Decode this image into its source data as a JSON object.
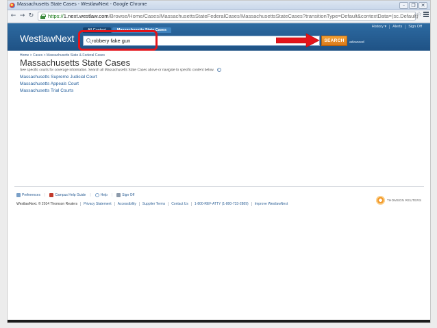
{
  "browser": {
    "window_title": "Massachusetts State Cases - WestlawNext - Google Chrome",
    "url_scheme": "https://",
    "url_host": "1.next.westlaw.com",
    "url_path": "/Browse/Home/Cases/MassachusettsStateFederalCases/MassachusettsStateCases?transitionType=Default&contextData=(sc.Default)"
  },
  "header": {
    "logo": "WestlawNext",
    "tabs": [
      "All Content",
      "Massachusetts State Cases"
    ],
    "search_value": "robbery fake gun",
    "search_button": "SEARCH",
    "advanced_link": "advanced",
    "util_links": [
      "History ▾",
      "Alerts",
      "Sign Off"
    ]
  },
  "content": {
    "breadcrumb": "Home > Cases > Massachusetts State & Federal Cases",
    "title": "Massachusetts State Cases",
    "intro": "See specific courts for coverage information. Search all Massachusetts State Cases above or navigate to specific content below.",
    "courts": [
      "Massachusetts Supreme Judicial Court",
      "Massachusetts Appeals Court",
      "Massachusetts Trial Courts"
    ]
  },
  "footer": {
    "links": [
      "Preferences",
      "Campus Help Guide",
      "Help",
      "Sign Off"
    ],
    "copyright": "WestlawNext. © 2014 Thomson Reuters",
    "bottom_links": [
      "Privacy Statement",
      "Accessibility",
      "Supplier Terms",
      "Contact Us",
      "1-800-REF-ATTY (1-800-733-2889)",
      "Improve WestlawNext"
    ],
    "brand": "THOMSON REUTERS"
  },
  "colors": {
    "header_blue": "#245e95",
    "search_orange": "#e88a25",
    "annotation_red": "#e3141b",
    "link_blue": "#215c9a"
  }
}
